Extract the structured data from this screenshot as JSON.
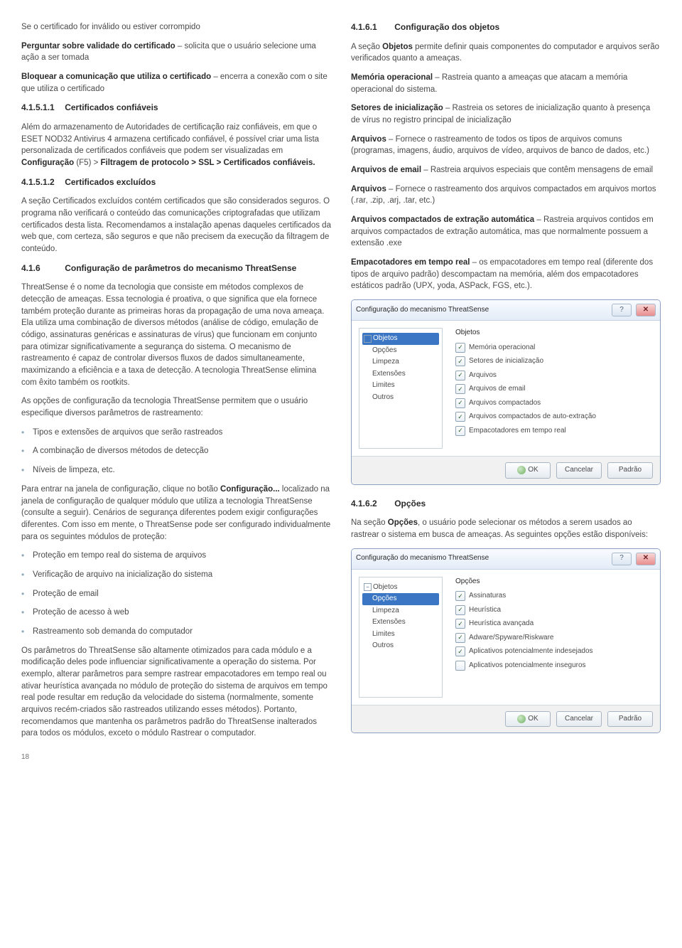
{
  "left": {
    "p1": "Se o certificado for inválido ou estiver corrompido",
    "p2_b": "Perguntar sobre validade do certificado",
    "p2_rest": " – solicita que o usuário selecione uma ação a ser tomada",
    "p3_b": "Bloquear a comunicação que utiliza o certificado",
    "p3_rest": " – encerra a conexão com o site que utiliza o certificado",
    "h1_num": "4.1.5.1.1",
    "h1_title": "Certificados confiáveis",
    "p4a": "Além do armazenamento de Autoridades de certificação raiz confiáveis, em que o ESET NOD32 Antivirus 4 armazena certificado confiável, é possível criar uma lista personalizada de certificados confiáveis que podem ser visualizadas em ",
    "p4b": "Configuração",
    "p4c": " (F5) > ",
    "p4d": "Filtragem de protocolo > SSL > Certificados confiáveis.",
    "h2_num": "4.1.5.1.2",
    "h2_title": "Certificados excluídos",
    "p5": "A seção Certificados excluídos contém certificados que são considerados seguros. O programa não verificará o conteúdo das comunicações criptografadas que utilizam certificados desta lista. Recomendamos a instalação apenas daqueles certificados da web que, com certeza, são seguros e que não precisem da execução da filtragem de conteúdo.",
    "h3_num": "4.1.6",
    "h3_title": "Configuração de parâmetros do mecanismo ThreatSense",
    "p6": "ThreatSense é o nome da tecnologia que consiste em métodos complexos de detecção de ameaças. Essa tecnologia é proativa, o que significa que ela fornece também proteção durante as primeiras horas da propagação de uma nova ameaça. Ela utiliza uma combinação de diversos métodos (análise de código, emulação de código, assinaturas genéricas e assinaturas de vírus) que funcionam em conjunto para otimizar significativamente a segurança do sistema. O mecanismo de rastreamento é capaz de controlar diversos fluxos de dados simultaneamente, maximizando a eficiência e a taxa de detecção. A tecnologia ThreatSense elimina com êxito também os rootkits.",
    "p7": "As opções de configuração da tecnologia ThreatSense permitem que o usuário especifique diversos parâmetros de rastreamento:",
    "ul1": [
      "Tipos e extensões de arquivos que serão rastreados",
      "A combinação de diversos métodos de detecção",
      "Níveis de limpeza, etc."
    ],
    "p8a": "Para entrar na janela de configuração, clique no botão ",
    "p8b": "Configuração...",
    "p8c": " localizado na janela de configuração de qualquer módulo que utiliza a tecnologia ThreatSense (consulte a seguir). Cenários de segurança diferentes podem exigir configurações diferentes. Com isso em mente, o ThreatSense pode ser configurado individualmente para os seguintes módulos de proteção:",
    "ul2": [
      "Proteção em tempo real do sistema de arquivos",
      "Verificação de arquivo na inicialização do sistema",
      "Proteção de email",
      "Proteção de acesso à web",
      "Rastreamento sob demanda do computador"
    ],
    "p9": "Os parâmetros do ThreatSense são altamente otimizados para cada módulo e a modificação deles pode influenciar significativamente a operação do sistema. Por exemplo, alterar parâmetros para sempre rastrear empacotadores em tempo real ou ativar heurística avançada no módulo de proteção do sistema de arquivos em tempo real pode resultar em redução da velocidade do sistema (normalmente, somente arquivos recém-criados são rastreados utilizando esses métodos). Portanto, recomendamos que mantenha os parâmetros padrão do ThreatSense inalterados para todos os módulos, exceto o módulo Rastrear o computador.",
    "pagenum": "18"
  },
  "right": {
    "h1_num": "4.1.6.1",
    "h1_title": "Configuração dos objetos",
    "p1a": "A seção ",
    "p1b": "Objetos",
    "p1c": " permite definir quais componentes do computador e arquivos serão verificados quanto a ameaças.",
    "def_mem_b": "Memória operacional",
    "def_mem_r": " – Rastreia quanto a ameaças que atacam a memória operacional do sistema.",
    "def_set_b": "Setores de inicialização",
    "def_set_r": " – Rastreia os setores de inicialização quanto à presença de vírus no registro principal de inicialização",
    "def_arq_b": "Arquivos",
    "def_arq_r": " – Fornece o rastreamento de todos os tipos de arquivos comuns (programas, imagens, áudio, arquivos de vídeo, arquivos de banco de dados, etc.)",
    "def_em_b": "Arquivos de email",
    "def_em_r": " – Rastreia arquivos especiais que contêm mensagens de email",
    "def_arq2_b": "Arquivos",
    "def_arq2_r": " – Fornece o rastreamento dos arquivos compactados em arquivos mortos (.rar, .zip, .arj, .tar, etc.)",
    "def_auto_b": "Arquivos compactados de extração automática",
    "def_auto_r": " – Rastreia arquivos contidos em arquivos compactados de extração automática, mas que normalmente possuem a extensão .exe",
    "def_rt_b": "Empacotadores em tempo real",
    "def_rt_r": " – os empacotadores em tempo real (diferente dos tipos de arquivo padrão) descompactam na memória, além dos empacotadores estáticos padrão (UPX, yoda, ASPack, FGS, etc.).",
    "h2_num": "4.1.6.2",
    "h2_title": "Opções",
    "p2a": "Na seção ",
    "p2b": "Opções",
    "p2c": ", o usuário pode selecionar os métodos a serem usados ao rastrear o sistema em busca de ameaças. As seguintes opções estão disponíveis:"
  },
  "dialog_common": {
    "title": "Configuração do mecanismo ThreatSense",
    "help": "?",
    "close_label": "✕",
    "tree": [
      "Objetos",
      "Opções",
      "Limpeza",
      "Extensões",
      "Limites",
      "Outros"
    ],
    "btn_ok": "OK",
    "btn_cancel": "Cancelar",
    "btn_default": "Padrão"
  },
  "dialog1": {
    "group": "Objetos",
    "checks": [
      {
        "label": "Memória operacional",
        "checked": true
      },
      {
        "label": "Setores de inicialização",
        "checked": true
      },
      {
        "label": "Arquivos",
        "checked": true
      },
      {
        "label": "Arquivos de email",
        "checked": true
      },
      {
        "label": "Arquivos compactados",
        "checked": true
      },
      {
        "label": "Arquivos compactados de auto-extração",
        "checked": true
      },
      {
        "label": "Empacotadores em tempo real",
        "checked": true
      }
    ],
    "selected_tree_index": 0
  },
  "dialog2": {
    "group": "Opções",
    "checks": [
      {
        "label": "Assinaturas",
        "checked": true
      },
      {
        "label": "Heurística",
        "checked": true
      },
      {
        "label": "Heurística avançada",
        "checked": true
      },
      {
        "label": "Adware/Spyware/Riskware",
        "checked": true
      },
      {
        "label": "Aplicativos potencialmente indesejados",
        "checked": true
      },
      {
        "label": "Aplicativos potencialmente inseguros",
        "checked": false
      }
    ],
    "selected_tree_index": 1
  }
}
